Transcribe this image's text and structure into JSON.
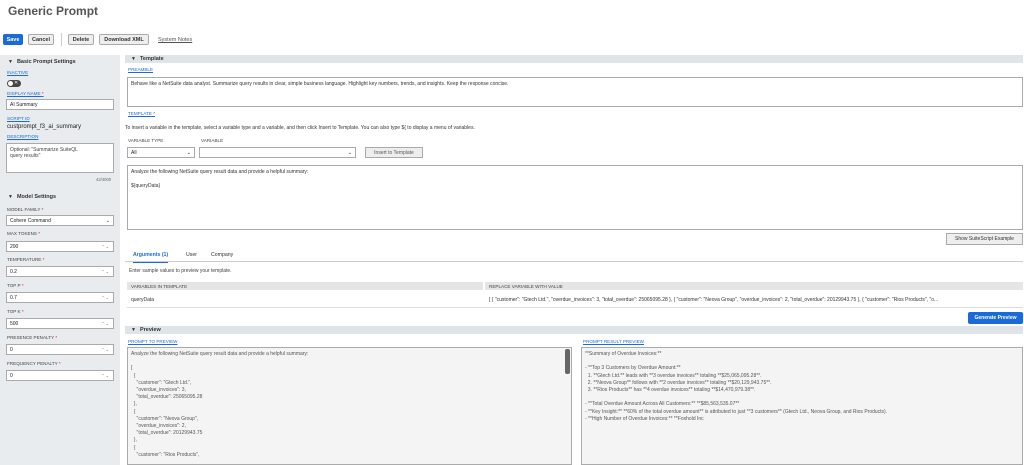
{
  "page": {
    "title": "Generic Prompt"
  },
  "toolbar": {
    "save": "Save",
    "cancel": "Cancel",
    "delete": "Delete",
    "download_xml": "Download XML",
    "system_notes": "System Notes"
  },
  "basic_settings": {
    "heading": "Basic Prompt Settings",
    "inactive_label": "INACTIVE",
    "display_name_label": "DISPLAY NAME",
    "display_name_value": "AI Summary",
    "script_id_label": "SCRIPT ID",
    "script_id_value": "custprompt_f3_ai_summary",
    "description_label": "DESCRIPTION",
    "description_value": "Optional: \"Summarize SuiteQL query results\"",
    "char_count": "42/4000"
  },
  "model_settings": {
    "heading": "Model Settings",
    "model_family_label": "MODEL FAMILY",
    "model_family_value": "Cohere Command",
    "max_tokens_label": "MAX TOKENS",
    "max_tokens_value": "200",
    "temperature_label": "TEMPERATURE",
    "temperature_value": "0.2",
    "top_p_label": "TOP P",
    "top_p_value": "0.7",
    "top_k_label": "TOP K",
    "top_k_value": "500",
    "presence_penalty_label": "PRESENCE PENALTY",
    "presence_penalty_value": "0",
    "frequency_penalty_label": "FREQUENCY PENALTY",
    "frequency_penalty_value": "0"
  },
  "template_section": {
    "heading": "Template",
    "preamble_label": "PREAMBLE",
    "preamble_value": "Behave like a NetSuite data analyst. Summarize query results in clear, simple business language. Highlight key numbers, trends, and insights. Keep the response concise.",
    "template_label": "TEMPLATE",
    "instructions": "To insert a variable in the template, select a variable type and a variable, and then click Insert to Template. You can also type ${ to display a menu of variables.",
    "variable_type_label": "VARIABLE TYPE",
    "variable_type_value": "All",
    "variable_label": "VARIABLE",
    "variable_value": "",
    "insert_button": "Insert to Template",
    "template_line1": "Analyze the following NetSuite query result data and provide a helpful summary:",
    "template_line2": "${queryData}",
    "show_example_button": "Show SuiteScript Example"
  },
  "tabs": {
    "arguments": "Arguments (1)",
    "user": "User",
    "company": "Company"
  },
  "arguments": {
    "hint": "Enter sample values to preview your template.",
    "col1": "VARIABLES IN TEMPLATE",
    "col2": "REPLACE VARIABLE WITH VALUE",
    "row_name": "queryData",
    "row_value": "[ { \"customer\": \"Gtech Ltd.\", \"overdue_invoices\": 3, \"total_overdue\": 25065095.28 }, { \"customer\": \"Neova Group\", \"overdue_invoices\": 2, \"total_overdue\": 20129943.75 }, { \"customer\": \"Rios Products\", \"o...",
    "generate_button": "Generate Preview"
  },
  "preview": {
    "heading": "Preview",
    "prompt_label": "PROMPT TO PREVIEW",
    "prompt_text": "Analyze the following NetSuite query result data and provide a helpful summary:\n\n[\n  {\n    \"customer\": \"Gtech Ltd.\",\n    \"overdue_invoices\": 3,\n    \"total_overdue\": 25065095.28\n  },\n  {\n    \"customer\": \"Neova Group\",\n    \"overdue_invoices\": 2,\n    \"total_overdue\": 20129943.75\n  },\n  {\n    \"customer\": \"Rios Products\",",
    "result_label": "PROMPT RESULT PREVIEW",
    "result_text": "**Summary of Overdue Invoices:**\n\n- **Top 3 Customers by Overdue Amount:**\n  1. **Gtech Ltd.** leads with **3 overdue invoices** totaling **$25,065,095.28**.\n  2. **Neova Group** follows with **2 overdue invoices** totaling **$20,129,943.75**.\n  3. **Rios Products** has **4 overdue invoices** totaling **$14,470,979.38**.\n\n- **Total Overdue Amount Across All Customers:** **$85,563,535.07**\n- **Key Insight:** **60% of the total overdue amount** is attributed to just **3 customers** (Gtech Ltd., Neova Group, and Rios Products).\n- **High Number of Overdue Invoices:** **Foxhold Inc"
  },
  "colors": {
    "accent": "#1a6bd8",
    "panel_bg": "#e8ecef"
  }
}
